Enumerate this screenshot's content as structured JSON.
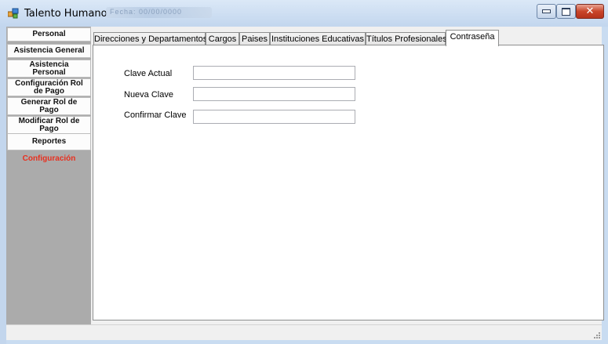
{
  "window": {
    "title": "Talento Humano",
    "title_extra": "Fecha: 00/00/0000"
  },
  "sidebar": {
    "items": [
      {
        "label": "Personal"
      },
      {
        "label": "Asistencia General"
      },
      {
        "label": "Asistencia Personal"
      },
      {
        "label": "Configuración Rol de Pago"
      },
      {
        "label": "Generar Rol de Pago"
      },
      {
        "label": "Modificar Rol de Pago"
      },
      {
        "label": "Reportes"
      },
      {
        "label": "Configuración"
      }
    ],
    "active_color": "#e8301f"
  },
  "tabs": [
    {
      "label": "Direcciones y Departamentos"
    },
    {
      "label": "Cargos"
    },
    {
      "label": "Paises"
    },
    {
      "label": "Instituciones Educativas"
    },
    {
      "label": "Títulos Profesionales"
    },
    {
      "label": "Contraseña"
    }
  ],
  "selected_tab": "Contraseña",
  "form": {
    "current_password_label": "Clave Actual",
    "current_password_value": "",
    "new_password_label": "Nueva Clave",
    "new_password_value": "",
    "confirm_password_label": "Confirmar Clave",
    "confirm_password_value": ""
  }
}
